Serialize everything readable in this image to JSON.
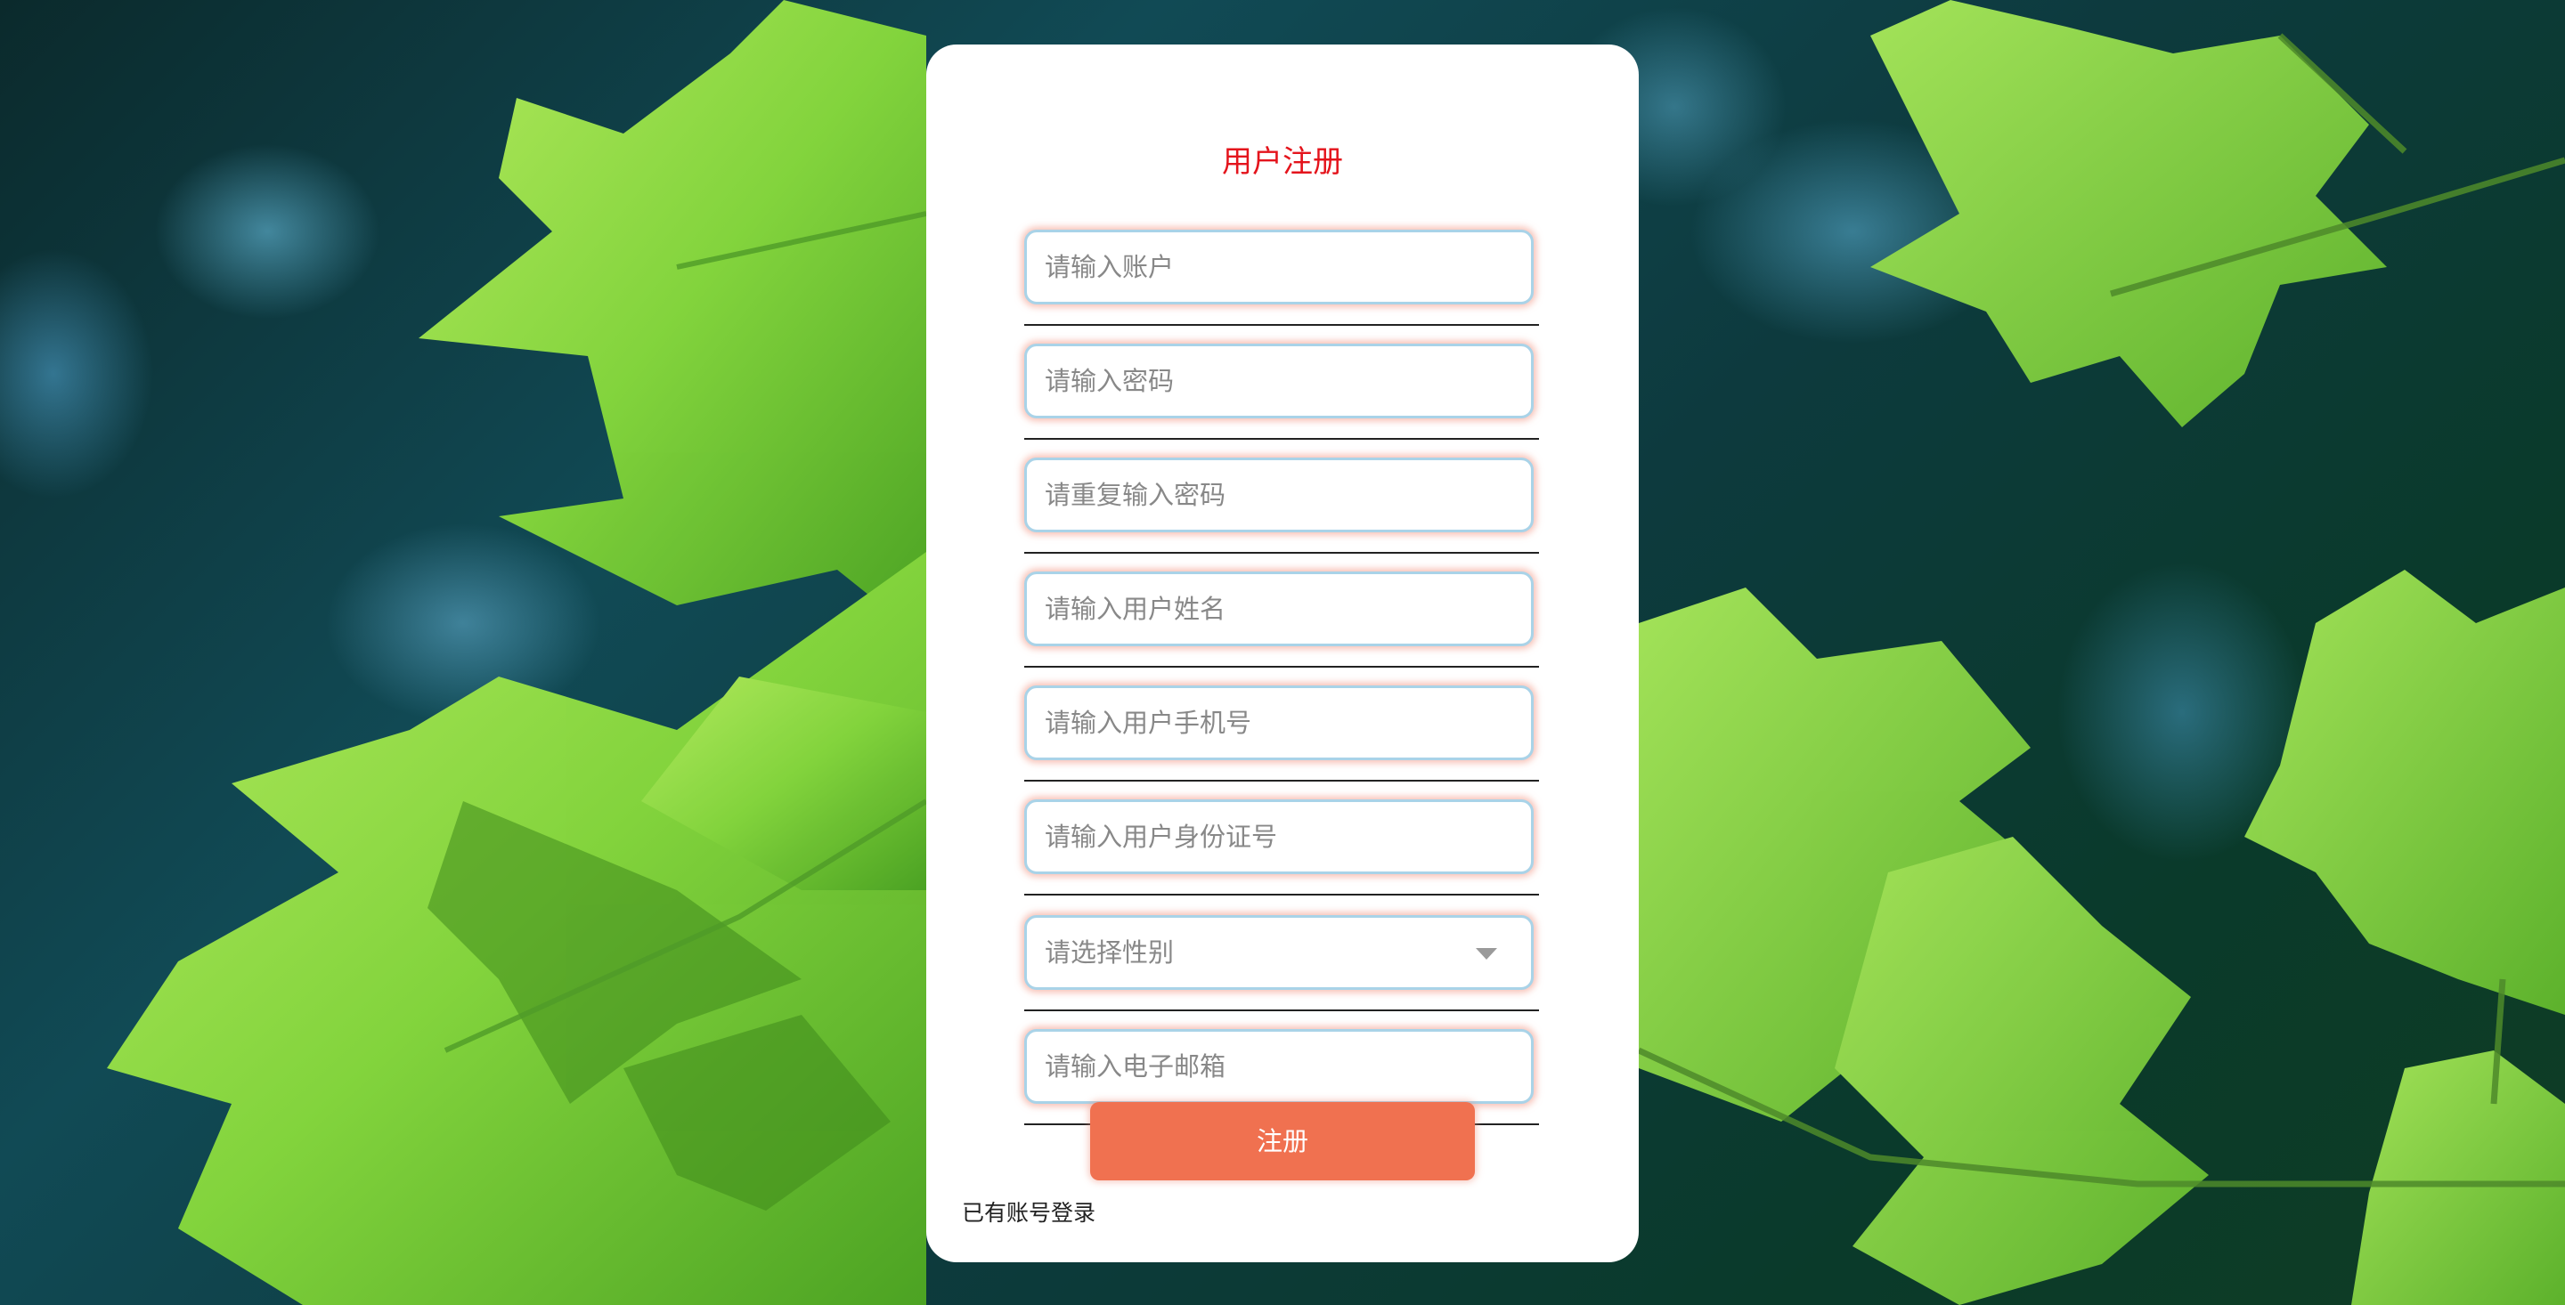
{
  "form": {
    "title": "用户注册",
    "fields": [
      {
        "placeholder": "请输入账户"
      },
      {
        "placeholder": "请输入密码"
      },
      {
        "placeholder": "请重复输入密码"
      },
      {
        "placeholder": "请输入用户姓名"
      },
      {
        "placeholder": "请输入用户手机号"
      },
      {
        "placeholder": "请输入用户身份证号"
      },
      {
        "placeholder": "请选择性别"
      },
      {
        "placeholder": "请输入电子邮箱"
      }
    ],
    "submit_label": "注册",
    "login_link": "已有账号登录"
  },
  "colors": {
    "title": "#e4141c",
    "button": "#f07150",
    "field_border": "#a9d3e8",
    "field_glow": "#f08c78",
    "leaf": "#7ed640"
  },
  "icons": {
    "select_caret": "chevron-down-icon"
  }
}
